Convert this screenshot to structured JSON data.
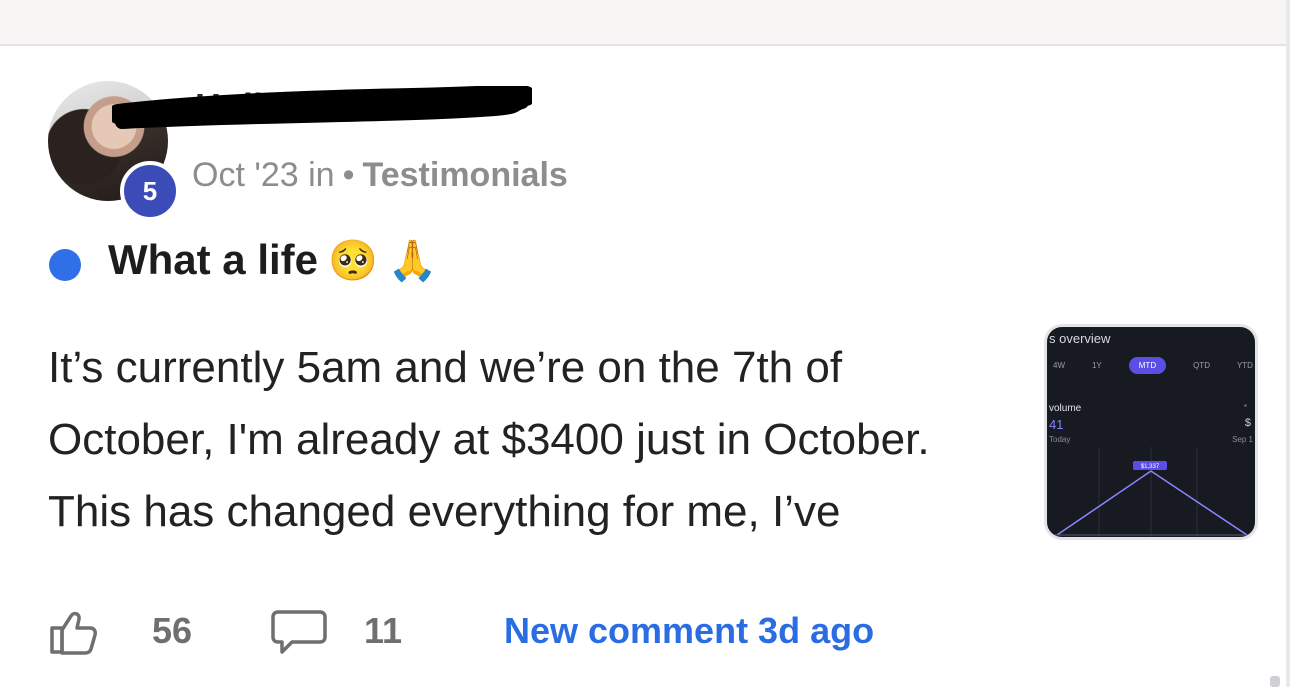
{
  "post": {
    "author_name": "Holbest Yo",
    "author_level": "5",
    "date": "Oct '23",
    "in_label": "in",
    "separator": "•",
    "category": "Testimonials",
    "title": "What a life",
    "title_emojis": [
      "🥺",
      "🙏"
    ],
    "body_lines": [
      "It’s currently 5am and we’re on the 7th of",
      "October, I'm already at $3400 just in October.",
      "This has changed everything for me, I’ve"
    ]
  },
  "thumbnail": {
    "title": "s overview",
    "tabs": [
      "4W",
      "1Y",
      "MTD",
      "QTD",
      "YTD"
    ],
    "active_tab": "MTD",
    "volume_label": "volume",
    "volume_value": "41",
    "today_label": "Today",
    "right_value": "$",
    "right_date": "Sep 1",
    "marker": "*",
    "tooltip": "$1,337"
  },
  "footer": {
    "likes": "56",
    "comments": "11",
    "new_comment": "New comment 3d ago"
  },
  "colors": {
    "accent_blue": "#2f6fe8",
    "badge": "#3b4bb8",
    "link": "#2a6de3"
  }
}
